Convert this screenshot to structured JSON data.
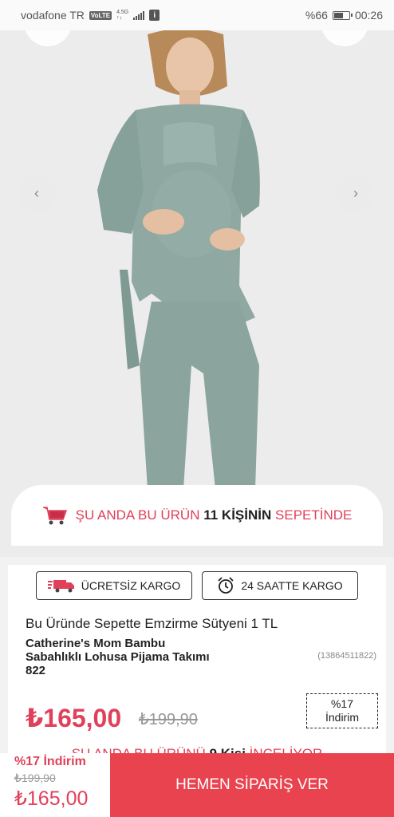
{
  "statusbar": {
    "carrier": "vodafone TR",
    "volte": "VoLTE",
    "net_top": "4.5G",
    "net_bottom": "↑↓",
    "info": "i",
    "battery_percent": "%66",
    "battery_level": 0.66,
    "time": "00:26"
  },
  "gallery": {
    "prev_icon": "chevron-left-icon",
    "next_icon": "chevron-right-icon"
  },
  "cart_banner": {
    "prefix": "ŞU ANDA BU ÜRÜN",
    "count": "11 KİŞİNİN",
    "suffix": "SEPETİNDE"
  },
  "badges": {
    "free_shipping": "ÜCRETSİZ KARGO",
    "fast_shipping": "24 SAATTE KARGO"
  },
  "product": {
    "promo": "Bu Üründe Sepette Emzirme Sütyeni 1 TL",
    "title_lines": [
      "Catherine's Mom Bambu",
      "Sabahlıklı Lohusa Pijama Takımı",
      "822"
    ],
    "code": "(13864511822)",
    "price": "₺165,00",
    "old_price": "₺199,90",
    "discount_line1": "%17",
    "discount_line2": "İndirim"
  },
  "viewers": {
    "prefix": "ŞU ANDA BU ÜRÜNÜ",
    "count": "9 Kişi",
    "suffix": "İNCELİYOR"
  },
  "bottombar": {
    "discount": "%17 İndirim",
    "old_price": "₺199,90",
    "price": "₺165,00",
    "button": "HEMEN SİPARİŞ VER"
  },
  "colors": {
    "accent": "#e0405a",
    "button": "#e8434f",
    "garment": "#8fa8a2"
  }
}
